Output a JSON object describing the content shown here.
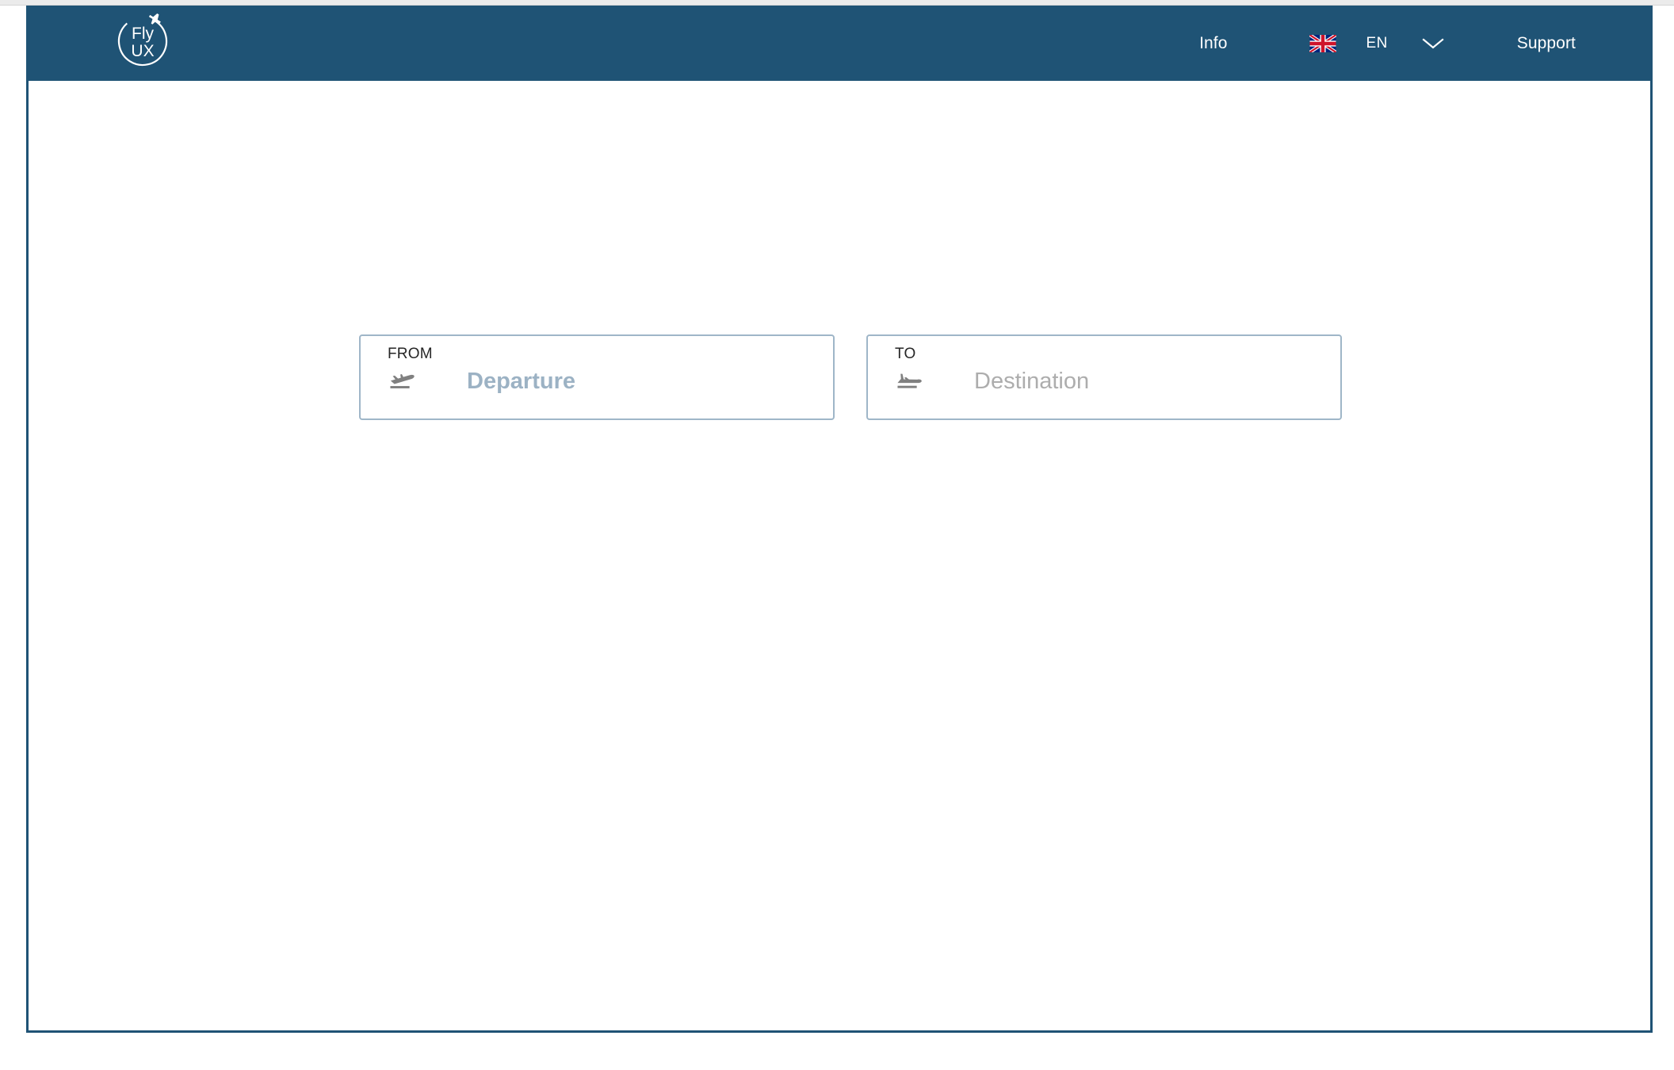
{
  "brand": {
    "logo_line1": "Fly",
    "logo_line2": "UX",
    "logo_icon": "airplane-icon",
    "header_color": "#1f5375"
  },
  "header": {
    "nav": {
      "info_label": "Info",
      "support_label": "Support",
      "language": {
        "code": "EN",
        "flag_icon": "uk-flag-icon",
        "chevron_icon": "chevron-down-icon"
      }
    }
  },
  "main": {
    "search": {
      "from_field": {
        "label": "FROM",
        "placeholder": "Departure",
        "value": "",
        "icon": "plane-takeoff-icon",
        "placeholder_color": "#9cb2c4"
      },
      "to_field": {
        "label": "TO",
        "placeholder": "Destination",
        "value": "",
        "icon": "plane-landing-icon",
        "placeholder_color": "#adadad"
      }
    }
  },
  "theme": {
    "accent": "#1f5375",
    "field_border": "#9fb6c8",
    "page_background": "#ffffff"
  }
}
